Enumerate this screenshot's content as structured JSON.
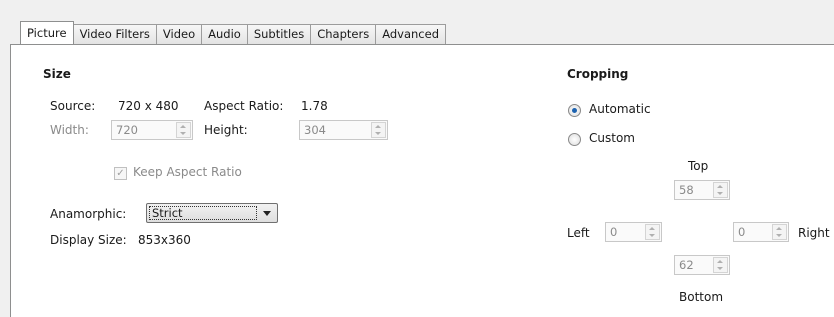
{
  "tabs": [
    "Picture",
    "Video Filters",
    "Video",
    "Audio",
    "Subtitles",
    "Chapters",
    "Advanced"
  ],
  "size": {
    "heading": "Size",
    "source_label": "Source:",
    "source_value": "720 x 480",
    "aspect_label": "Aspect Ratio:",
    "aspect_value": "1.78",
    "width_label": "Width:",
    "width_value": "720",
    "height_label": "Height:",
    "height_value": "304",
    "keep_aspect_label": "Keep Aspect Ratio",
    "keep_aspect_checked": true,
    "anamorphic_label": "Anamorphic:",
    "anamorphic_value": "Strict",
    "display_size_label": "Display Size:",
    "display_size_value": "853x360"
  },
  "cropping": {
    "heading": "Cropping",
    "automatic_label": "Automatic",
    "custom_label": "Custom",
    "selected": "Automatic",
    "top_label": "Top",
    "top_value": "58",
    "left_label": "Left",
    "left_value": "0",
    "right_value": "0",
    "right_label": "Right",
    "bottom_value": "62",
    "bottom_label": "Bottom"
  },
  "icons": {
    "checkmark": "✓",
    "radio_selected_color": "#1e63b0"
  }
}
